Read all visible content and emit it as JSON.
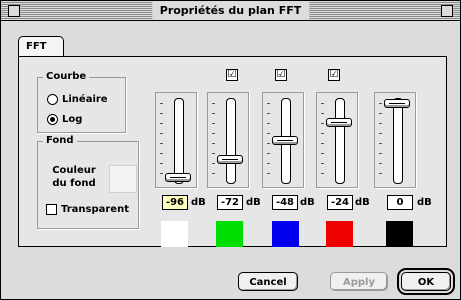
{
  "window": {
    "title": "Propriétés du plan FFT"
  },
  "tabs": [
    {
      "label": "FFT"
    }
  ],
  "courbe": {
    "label": "Courbe",
    "options": [
      {
        "label": "Linéaire",
        "selected": false
      },
      {
        "label": "Log",
        "selected": true
      }
    ]
  },
  "fond": {
    "label": "Fond",
    "couleur_label": "Couleur du fond",
    "couleur": "#f3f3f3",
    "transparent_label": "Transparent",
    "transparent_checked": false
  },
  "sliders": [
    {
      "enabled_checkbox": false,
      "value": "-96",
      "unit": "dB",
      "level": 0.0,
      "color": "#ffffff",
      "focused": true
    },
    {
      "enabled_checkbox": true,
      "checked": true,
      "value": "-72",
      "unit": "dB",
      "level": 0.25,
      "color": "#00dd00",
      "focused": false
    },
    {
      "enabled_checkbox": true,
      "checked": true,
      "value": "-48",
      "unit": "dB",
      "level": 0.5,
      "color": "#0000ee",
      "focused": false
    },
    {
      "enabled_checkbox": true,
      "checked": true,
      "value": "-24",
      "unit": "dB",
      "level": 0.75,
      "color": "#ee0000",
      "focused": false
    },
    {
      "enabled_checkbox": false,
      "value": "0",
      "unit": "dB",
      "level": 1.0,
      "color": "#000000",
      "focused": false
    }
  ],
  "buttons": {
    "cancel": "Cancel",
    "apply": "Apply",
    "ok": "OK"
  },
  "check_glyph": "☑"
}
